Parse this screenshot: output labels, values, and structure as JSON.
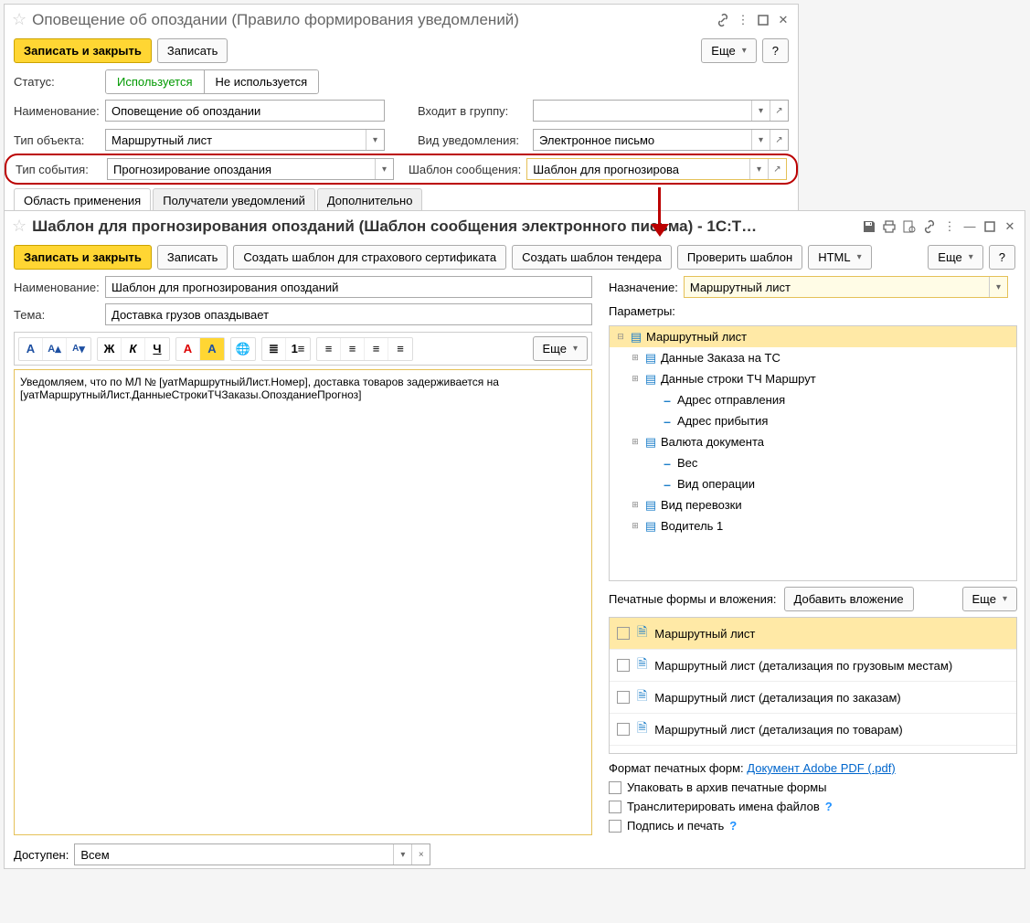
{
  "window1": {
    "title": "Оповещение об опоздании (Правило формирования уведомлений)",
    "save_close": "Записать и закрыть",
    "save": "Записать",
    "more": "Еще",
    "help": "?",
    "status_label": "Статус:",
    "status_used": "Используется",
    "status_notused": "Не используется",
    "name_label": "Наименование:",
    "name_value": "Оповещение об опоздании",
    "group_label": "Входит в группу:",
    "group_value": "",
    "objtype_label": "Тип объекта:",
    "objtype_value": "Маршрутный лист",
    "notiftype_label": "Вид уведомления:",
    "notiftype_value": "Электронное письмо",
    "eventtype_label": "Тип события:",
    "eventtype_value": "Прогнозирование опоздания",
    "template_label": "Шаблон сообщения:",
    "template_value": "Шаблон для прогнозирова",
    "tab1": "Область применения",
    "tab2": "Получатели уведомлений",
    "tab3": "Дополнительно"
  },
  "window2": {
    "title": "Шаблон для прогнозирования опозданий (Шаблон сообщения электронного письма) - 1С:Т…",
    "save_close": "Записать и закрыть",
    "save": "Записать",
    "create_cert": "Создать шаблон для страхового сертификата",
    "create_tender": "Создать шаблон тендера",
    "check_tmpl": "Проверить шаблон",
    "html_btn": "HTML",
    "more": "Еще",
    "help": "?",
    "name_label": "Наименование:",
    "name_value": "Шаблон для прогнозирования опозданий",
    "subject_label": "Тема:",
    "subject_value": "Доставка грузов опаздывает",
    "body": "Уведомляем, что по МЛ № [уатМаршрутныйЛист.Номер],  доставка товаров задерживается на [уатМаршрутныйЛист.ДанныеСтрокиТЧЗаказы.ОпозданиеПрогноз]",
    "ed_more": "Еще",
    "assign_label": "Назначение:",
    "assign_value": "Маршрутный лист",
    "params_label": "Параметры:",
    "tree": {
      "root": "Маршрутный лист",
      "n1": "Данные Заказа на ТС",
      "n2": "Данные строки ТЧ Маршрут",
      "n3": "Адрес отправления",
      "n4": "Адрес прибытия",
      "n5": "Валюта документа",
      "n6": "Вес",
      "n7": "Вид операции",
      "n8": "Вид перевозки",
      "n9": "Водитель 1"
    },
    "attach_label": "Печатные формы и вложения:",
    "attach_add": "Добавить вложение",
    "attach_more": "Еще",
    "attach": {
      "a1": "Маршрутный лист",
      "a2": "Маршрутный лист (детализация по грузовым местам)",
      "a3": "Маршрутный лист (детализация по заказам)",
      "a4": "Маршрутный лист (детализация по товарам)"
    },
    "format_label": "Формат печатных форм:",
    "format_link": "Документ Adobe PDF (.pdf)",
    "opt1": "Упаковать в архив печатные формы",
    "opt2": "Транслитерировать имена файлов",
    "opt3": "Подпись и печать",
    "access_label": "Доступен:",
    "access_value": "Всем"
  }
}
